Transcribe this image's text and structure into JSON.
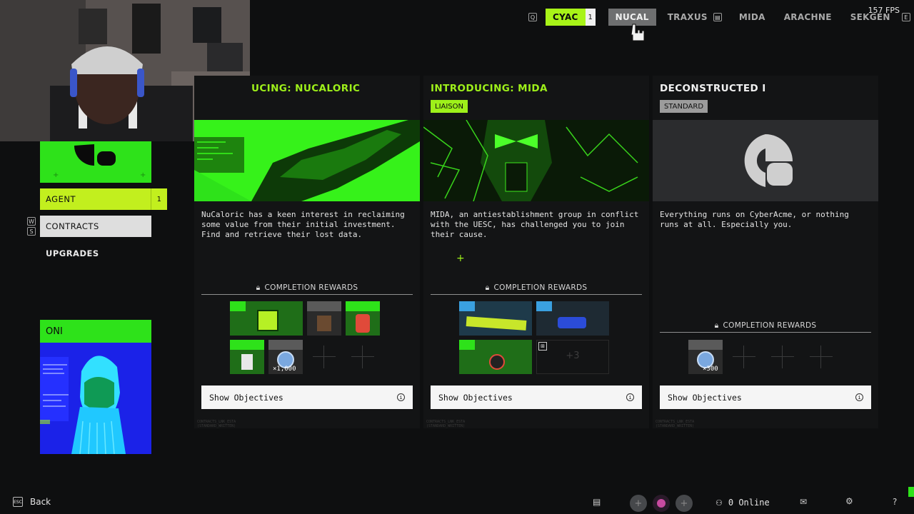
{
  "fps": "157 FPS",
  "factions": [
    {
      "label": "CYAC",
      "count": "1",
      "state": "active"
    },
    {
      "label": "NUCAL",
      "state": "hover"
    },
    {
      "label": "TRAXUS",
      "state": "normal"
    },
    {
      "label": "MIDA",
      "state": "normal"
    },
    {
      "label": "ARACHNE",
      "state": "normal"
    },
    {
      "label": "SEKGEN",
      "state": "normal"
    }
  ],
  "key_hints": {
    "left": "Q",
    "right": "E",
    "w": "W",
    "s": "S"
  },
  "nav": {
    "agent": "AGENT",
    "agent_count": "1",
    "contracts": "CONTRACTS",
    "upgrades": "UPGRADES"
  },
  "runner": {
    "name": "ONI"
  },
  "cards": [
    {
      "title": "UCING: NUCALORIC",
      "desc": "NuCaloric has a keen interest in reclaiming some value from their initial investment. Find and retrieve their lost data.",
      "rewards_label": "COMPLETION REWARDS",
      "reward_qty": "×1,000",
      "objectives": "Show Objectives",
      "micro": "CONTRACTS_LNK_ESTA\n(STANDARD_WRITTEN)"
    },
    {
      "title": "INTRODUCING: MIDA",
      "tag": "LIAISON",
      "desc": "MIDA, an antiestablishment group in conflict with the UESC, has challenged you to join their cause.",
      "rewards_label": "COMPLETION REWARDS",
      "more_rewards": "+3",
      "objectives": "Show Objectives",
      "micro": "CONTRACTS_LNK_ESTA\n(STANDARD_WRITTEN)"
    },
    {
      "title": "DECONSTRUCTED I",
      "tag": "STANDARD",
      "desc": "Everything runs on CyberAcme, or nothing runs at all. Especially you.",
      "rewards_label": "COMPLETION REWARDS",
      "reward_qty": "×300",
      "objectives": "Show Objectives",
      "micro": "CONTRACTS_LNK_ESTA\n(STANDARD_WRITTEN)"
    }
  ],
  "bottom": {
    "back": "Back",
    "online": "0 Online",
    "esc_hint": "ESC"
  },
  "colors": {
    "accent_green": "#2ee21a",
    "lime": "#a8f318",
    "bg": "#0e0f10"
  }
}
